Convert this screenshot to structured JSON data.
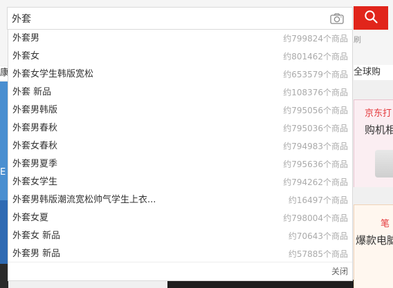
{
  "search": {
    "value": "外套"
  },
  "background": {
    "left_strip_text": "康",
    "left_banner_text": "E",
    "right_top_small": "刷",
    "right_nav": "全球购",
    "card1_title": "京东打",
    "card1_subtitle": "购机相",
    "card2_title": "笔",
    "card2_subtitle": "爆款电脑"
  },
  "suggestions": [
    {
      "keyword": "外套男",
      "count": "约799824个商品"
    },
    {
      "keyword": "外套女",
      "count": "约801462个商品"
    },
    {
      "keyword": "外套女学生韩版宽松",
      "count": "约653579个商品"
    },
    {
      "keyword": "外套 新品",
      "count": "约108376个商品"
    },
    {
      "keyword": "外套男韩版",
      "count": "约795056个商品"
    },
    {
      "keyword": "外套男春秋",
      "count": "约795036个商品"
    },
    {
      "keyword": "外套女春秋",
      "count": "约794983个商品"
    },
    {
      "keyword": "外套男夏季",
      "count": "约795636个商品"
    },
    {
      "keyword": "外套女学生",
      "count": "约794262个商品"
    },
    {
      "keyword": "外套男韩版潮流宽松帅气学生上衣...",
      "count": "约16497个商品"
    },
    {
      "keyword": "外套女夏",
      "count": "约798004个商品"
    },
    {
      "keyword": "外套女 新品",
      "count": "约70643个商品"
    },
    {
      "keyword": "外套男 新品",
      "count": "约57885个商品"
    }
  ],
  "dropdown": {
    "close_label": "关闭"
  },
  "colors": {
    "accent": "#e1251b",
    "count_text": "#aaaaaa"
  }
}
